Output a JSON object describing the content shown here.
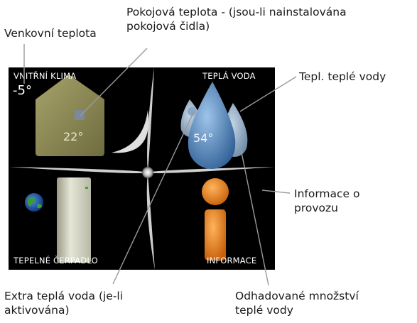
{
  "callouts": {
    "outdoor_temp": "Venkovní teplota",
    "room_temp_line1": "Pokojová teplota - (jsou-li nainstalována",
    "room_temp_line2": "pokojová čidla)",
    "hot_water_temp": "Tepl. teplé vody",
    "operation_info_line1": "Informace o",
    "operation_info_line2": "provozu",
    "extra_hot_water_line1": "Extra teplá voda (je-li",
    "extra_hot_water_line2": "aktivována)",
    "estimated_hot_water_line1": "Odhadované množství",
    "estimated_hot_water_line2": "teplé vody"
  },
  "screen": {
    "indoor_climate_label": "VNITŘNÍ KLIMA",
    "hot_water_label": "TEPLÁ VODA",
    "heat_pump_label": "TEPELNÉ ČERPADLO",
    "info_label": "INFORMACE",
    "outdoor_value": "-5°",
    "room_value": "22°",
    "hot_water_value": "54°"
  },
  "colors": {
    "screen_bg": "#000000",
    "house": "#8e8a55",
    "water_drop": "#5a8ec4",
    "info_orange": "#e8861e",
    "leader_line": "#9a9a9a"
  }
}
